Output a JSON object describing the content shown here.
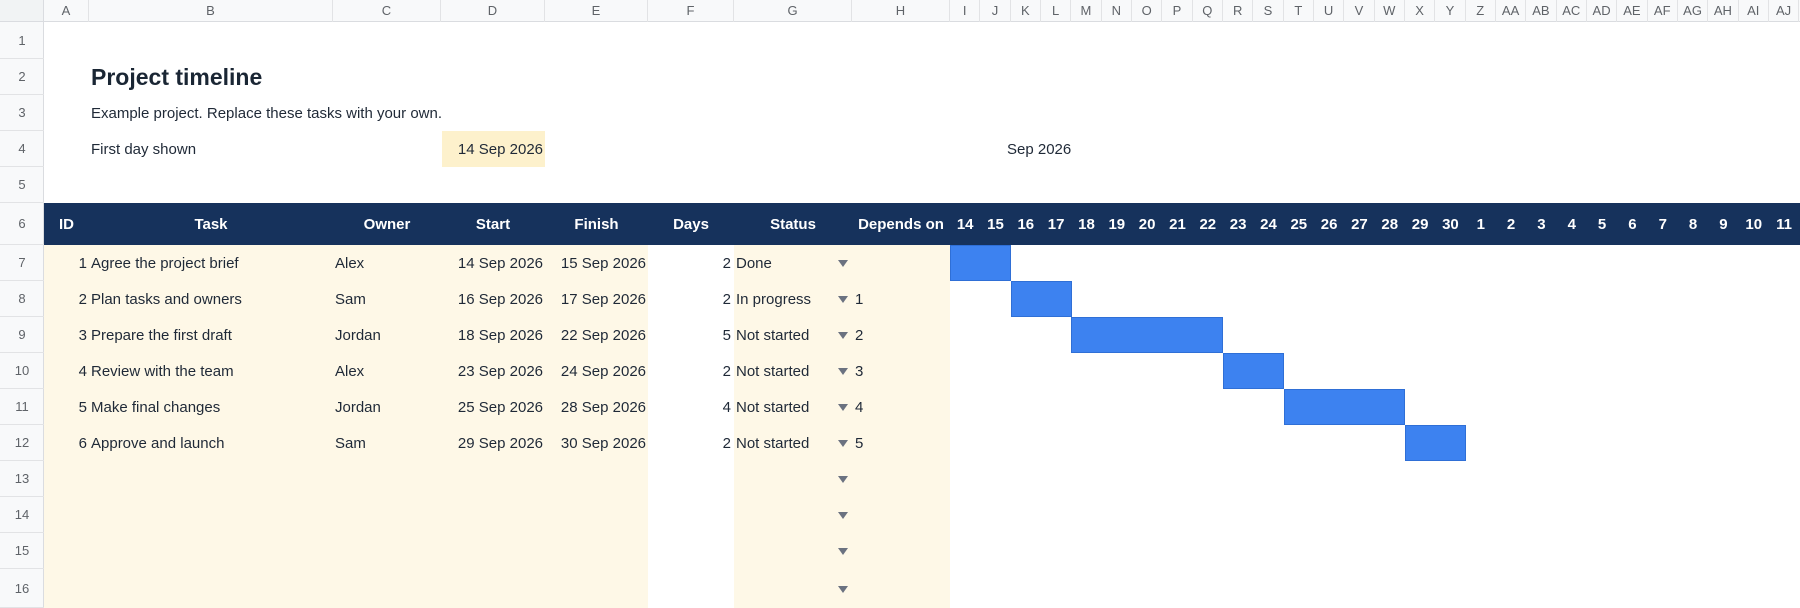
{
  "columns": [
    "A",
    "B",
    "C",
    "D",
    "E",
    "F",
    "G",
    "H",
    "I",
    "J",
    "K",
    "L",
    "M",
    "N",
    "O",
    "P",
    "Q",
    "R",
    "S",
    "T",
    "U",
    "V",
    "W",
    "X",
    "Y",
    "Z",
    "AA",
    "AB",
    "AC",
    "AD",
    "AE",
    "AF",
    "AG",
    "AH",
    "AI",
    "AJ"
  ],
  "rows": [
    "1",
    "2",
    "3",
    "4",
    "5",
    "6",
    "7",
    "8",
    "9",
    "10",
    "11",
    "12",
    "13",
    "14",
    "15",
    "16"
  ],
  "title": "Project timeline",
  "subtitle": "Example project. Replace these tasks with your own.",
  "first_day_label": "First day shown",
  "first_day_value": "14 Sep 2026",
  "month_label": "Sep 2026",
  "table_headers": {
    "id": "ID",
    "task": "Task",
    "owner": "Owner",
    "start": "Start",
    "finish": "Finish",
    "days": "Days",
    "status": "Status",
    "depends": "Depends on"
  },
  "day_headers": [
    "14",
    "15",
    "16",
    "17",
    "18",
    "19",
    "20",
    "21",
    "22",
    "23",
    "24",
    "25",
    "26",
    "27",
    "28",
    "29",
    "30",
    "1",
    "2",
    "3",
    "4",
    "5",
    "6",
    "7",
    "8",
    "9",
    "10",
    "11"
  ],
  "tasks": [
    {
      "id": "1",
      "task": "Agree the project brief",
      "owner": "Alex",
      "start": "14 Sep 2026",
      "finish": "15 Sep 2026",
      "days": "2",
      "status": "Done",
      "depends": "",
      "bar_start_day": 0,
      "bar_days": 2
    },
    {
      "id": "2",
      "task": "Plan tasks and owners",
      "owner": "Sam",
      "start": "16 Sep 2026",
      "finish": "17 Sep 2026",
      "days": "2",
      "status": "In progress",
      "depends": "1",
      "bar_start_day": 2,
      "bar_days": 2
    },
    {
      "id": "3",
      "task": "Prepare the first draft",
      "owner": "Jordan",
      "start": "18 Sep 2026",
      "finish": "22 Sep 2026",
      "days": "5",
      "status": "Not started",
      "depends": "2",
      "bar_start_day": 4,
      "bar_days": 5
    },
    {
      "id": "4",
      "task": "Review with the team",
      "owner": "Alex",
      "start": "23 Sep 2026",
      "finish": "24 Sep 2026",
      "days": "2",
      "status": "Not started",
      "depends": "3",
      "bar_start_day": 9,
      "bar_days": 2
    },
    {
      "id": "5",
      "task": "Make final changes",
      "owner": "Jordan",
      "start": "25 Sep 2026",
      "finish": "28 Sep 2026",
      "days": "4",
      "status": "Not started",
      "depends": "4",
      "bar_start_day": 11,
      "bar_days": 4
    },
    {
      "id": "6",
      "task": "Approve and launch",
      "owner": "Sam",
      "start": "29 Sep 2026",
      "finish": "30 Sep 2026",
      "days": "2",
      "status": "Not started",
      "depends": "5",
      "bar_start_day": 15,
      "bar_days": 2
    }
  ],
  "empty_dropdown_rows": 4,
  "colors": {
    "header_band": "#16325c",
    "input_tint": "#fef8e7",
    "date_input": "#fdf1cc",
    "gantt_bar": "#3d82f0"
  }
}
